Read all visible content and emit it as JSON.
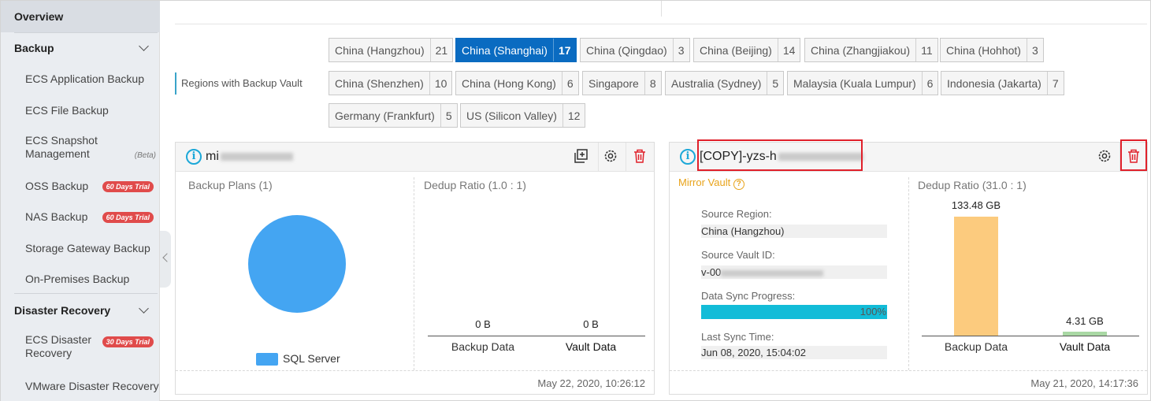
{
  "sidebar": {
    "overview": "Overview",
    "backup_header": "Backup",
    "items_backup": [
      {
        "label": "ECS Application Backup"
      },
      {
        "label": "ECS File Backup"
      },
      {
        "label": "ECS Snapshot Management",
        "tag": "(Beta)"
      },
      {
        "label": "OSS Backup",
        "badge": "60 Days Trial"
      },
      {
        "label": "NAS Backup",
        "badge": "60 Days Trial"
      },
      {
        "label": "Storage Gateway Backup"
      },
      {
        "label": "On-Premises Backup"
      }
    ],
    "dr_header": "Disaster Recovery",
    "items_dr": [
      {
        "label": "ECS Disaster Recovery",
        "badge": "30 Days Trial"
      },
      {
        "label": "VMware Disaster Recovery"
      }
    ]
  },
  "regions_label": "Regions with Backup Vault",
  "regions": [
    {
      "name": "China (Hangzhou)",
      "count": "21"
    },
    {
      "name": "China (Shanghai)",
      "count": "17",
      "selected": true
    },
    {
      "name": "China (Qingdao)",
      "count": "3"
    },
    {
      "name": "China (Beijing)",
      "count": "14"
    },
    {
      "name": "China (Zhangjiakou)",
      "count": "11"
    },
    {
      "name": "China (Hohhot)",
      "count": "3"
    },
    {
      "name": "China (Shenzhen)",
      "count": "10"
    },
    {
      "name": "China (Hong Kong)",
      "count": "6"
    },
    {
      "name": "Singapore",
      "count": "8"
    },
    {
      "name": "Australia (Sydney)",
      "count": "5"
    },
    {
      "name": "Malaysia (Kuala Lumpur)",
      "count": "6"
    },
    {
      "name": "Indonesia (Jakarta)",
      "count": "7"
    },
    {
      "name": "Germany (Frankfurt)",
      "count": "5"
    },
    {
      "name": "US (Silicon Valley)",
      "count": "12"
    }
  ],
  "card1": {
    "title_prefix": "mi",
    "plans_title": "Backup Plans (1)",
    "dedup_title": "Dedup Ratio (1.0 : 1)",
    "legend": "SQL Server",
    "pie_color": "#44a5f2",
    "chart": {
      "type": "bar",
      "categories": [
        "Backup Data",
        "Vault Data"
      ],
      "value_labels": [
        "0 B",
        "0 B"
      ],
      "values": [
        0,
        0
      ]
    },
    "timestamp": "May 22, 2020, 10:26:12"
  },
  "card2": {
    "title_prefix": "[COPY]-yzs-h",
    "mirror_label": "Mirror Vault",
    "source_region_label": "Source Region:",
    "source_region": "China (Hangzhou)",
    "source_vault_label": "Source Vault ID:",
    "source_vault_prefix": "v-00",
    "sync_label": "Data Sync Progress:",
    "sync_progress": "100%",
    "sync_progress_value": 100,
    "last_sync_label": "Last Sync Time:",
    "last_sync": "Jun 08, 2020, 15:04:02",
    "dedup_title": "Dedup Ratio (31.0 : 1)",
    "chart": {
      "type": "bar",
      "categories": [
        "Backup Data",
        "Vault Data"
      ],
      "value_labels": [
        "133.48 GB",
        "4.31 GB"
      ],
      "values": [
        133.48,
        4.31
      ],
      "colors": [
        "#fccb7e",
        "#a9d8a4"
      ]
    },
    "timestamp": "May 21, 2020, 14:17:36"
  }
}
